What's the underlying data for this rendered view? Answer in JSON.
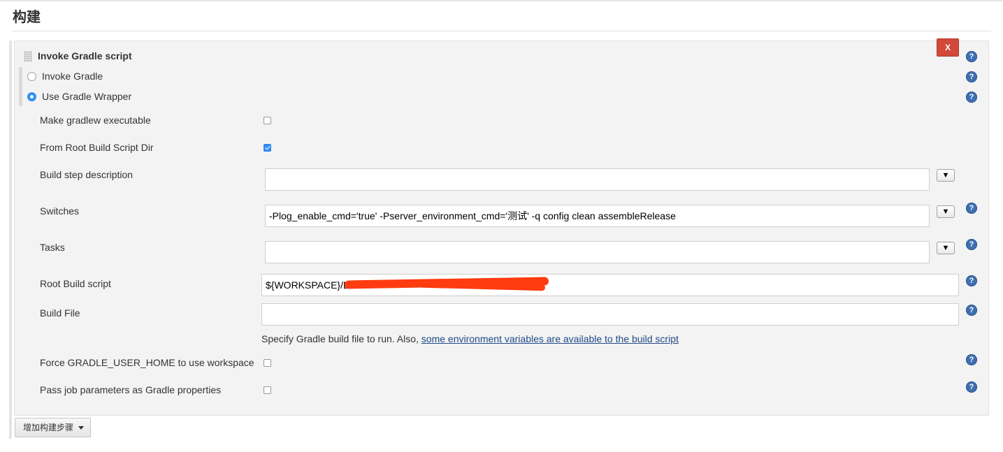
{
  "section": {
    "title": "构建"
  },
  "step": {
    "title": "Invoke Gradle script",
    "delete_label": "X",
    "options": [
      {
        "label": "Invoke Gradle",
        "selected": false
      },
      {
        "label": "Use Gradle Wrapper",
        "selected": true
      }
    ]
  },
  "fields": {
    "make_executable": {
      "label": "Make gradlew executable",
      "checked": false
    },
    "from_root_dir": {
      "label": "From Root Build Script Dir",
      "checked": true
    },
    "description": {
      "label": "Build step description",
      "value": ""
    },
    "switches": {
      "label": "Switches",
      "value": "-Plog_enable_cmd='true' -Pserver_environment_cmd='测试' -q config clean assembleRelease"
    },
    "tasks": {
      "label": "Tasks",
      "value": ""
    },
    "root_script": {
      "label": "Root Build script",
      "value": "${WORKSPACE}/D"
    },
    "build_file": {
      "label": "Build File",
      "value": "",
      "hint": "Specify Gradle build file to run. Also,",
      "hint_link": "some environment variables are available to the build script"
    },
    "force_home": {
      "label": "Force GRADLE_USER_HOME to use workspace",
      "checked": false
    },
    "pass_params": {
      "label": "Pass job parameters as Gradle properties",
      "checked": false
    }
  },
  "icons": {
    "help": "?",
    "expand": "▼"
  },
  "add_step": {
    "label": "增加构建步骤"
  },
  "colors": {
    "delete": "#d24939",
    "accent": "#2f8ef7",
    "help": "#3e6fb0",
    "redaction": "#ff3b10"
  }
}
